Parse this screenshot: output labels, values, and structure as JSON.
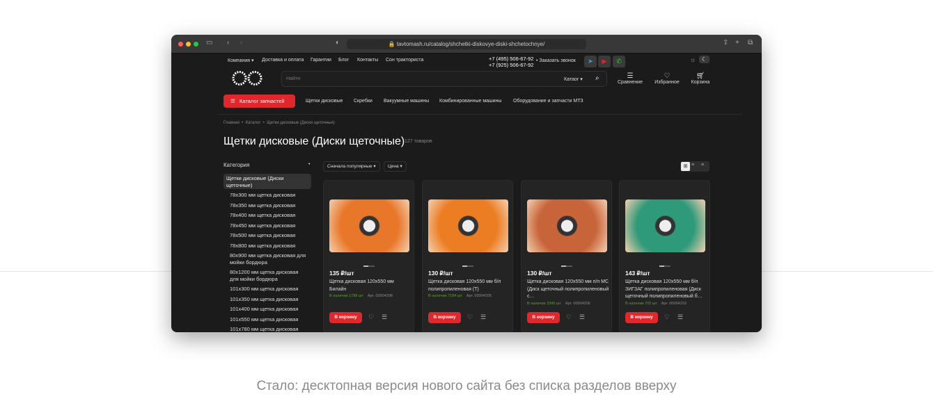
{
  "browser": {
    "url": "tavtomash.ru/catalog/shchetki-diskovye-diski-shchetochnye/"
  },
  "topnav": {
    "links": [
      "Компания",
      "Доставка и оплата",
      "Гарантии",
      "Блог",
      "Контакты",
      "Сон тракториста"
    ],
    "phone1": "+7 (495) 506-67-92",
    "phone2": "+7 (925) 506-67-92",
    "callback": "Заказать звонок"
  },
  "search": {
    "placeholder": "Найти",
    "scope": "Катаог"
  },
  "actions": {
    "compare": "Сравнение",
    "favorites": "Избранное",
    "cart": "Корзина"
  },
  "mainnav": {
    "catalog_button": "Каталог запчастей",
    "links": [
      "Щетки дисковые",
      "Скребки",
      "Вакуумные машины",
      "Комбинированные машины",
      "Оборудование и запчасти МТЗ"
    ]
  },
  "breadcrumb": [
    "Главная",
    "Каталог",
    "Щетки дисковые (Диски щеточные)"
  ],
  "page": {
    "title": "Щетки дисковые (Диски щеточные)",
    "count": "127 товаров"
  },
  "sidebar": {
    "heading": "Категория",
    "active": "Щетки дисковые (Диски щеточные)",
    "items": [
      "78x300 мм щетка дисковая",
      "78x350 мм щетка дисковая",
      "78x400 мм щетка дисковая",
      "78x450 мм щетка дисковая",
      "78x500 мм щетка дисковая",
      "78x800 мм щетка дисковая",
      "80x900 мм щетка дисковая для мойки бордюра",
      "80x1200 мм щетка дисковая для мойки бордюра",
      "101x300 мм щетка дисковая",
      "101x350 мм щетка дисковая",
      "101x400 мм щетка дисковая",
      "101x550 мм щетка дисковая",
      "101x780 мм щетка дисковая"
    ]
  },
  "sort": {
    "popular": "Сначала популярные",
    "price": "Цена"
  },
  "products": [
    {
      "price": "135 ₽/шт",
      "name": "Щетка дисковая 120x550 мм Билайн",
      "stock": "В наличии 1788 шт",
      "art": "Арт. 00004208",
      "color": "#e8772a"
    },
    {
      "price": "130 ₽/шт",
      "name": "Щетка дисковая 120x550 мм б/п полипропиленовая (Т)",
      "stock": "В наличии 7184 шт",
      "art": "Арт. 00004205",
      "color": "#ec7d22"
    },
    {
      "price": "130 ₽/шт",
      "name": "Щетка дисковая 120x550 мм п/п МС (Диск щеточный полипропиленовый с…",
      "stock": "В наличии 3390 шт",
      "art": "Арт. 00004206",
      "color": "#c8643a"
    },
    {
      "price": "143 ₽/шт",
      "name": "Щетка дисковая 120x550 мм б/п ЗИГЗАГ полипропиленовая (Диск щеточный полипропиленовый б…",
      "stock": "В наличии 705 шт",
      "art": "Арт. 00004203",
      "color": "#2f9a7a"
    }
  ],
  "buy_label": "В корзину",
  "caption": "Стало: десктопная версия нового сайта без списка разделов вверху"
}
